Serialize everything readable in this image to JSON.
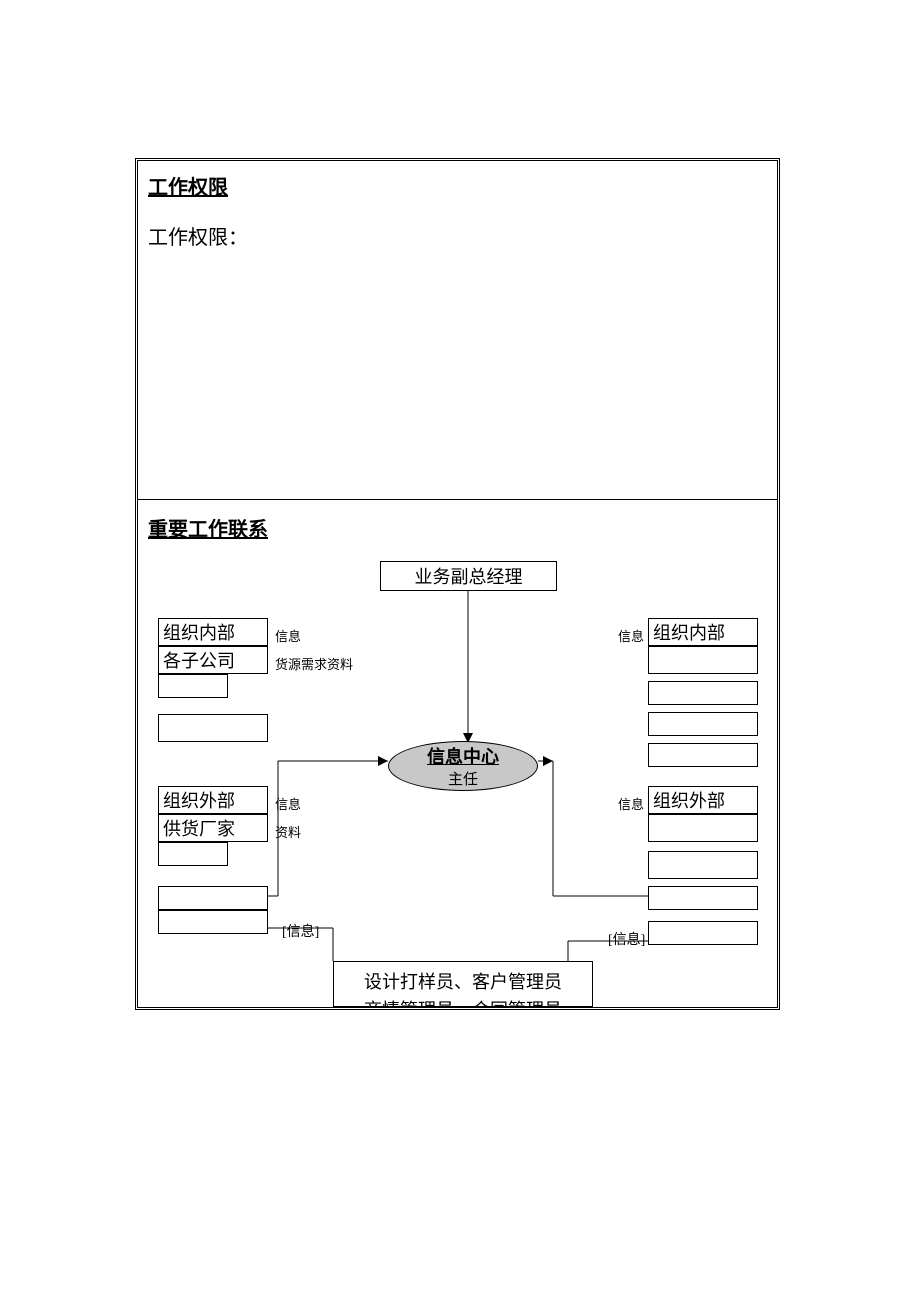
{
  "section1": {
    "title": "工作权限",
    "text": "工作权限："
  },
  "section2": {
    "title": "重要工作联系"
  },
  "diagram": {
    "top_box": "业务副总经理",
    "center_line1": "信息中心",
    "center_line2": "主任",
    "left": {
      "header1": "组织内部",
      "label1a": "信息",
      "row2": "各子公司",
      "label1b": "货源需求资料",
      "header2": "组织外部",
      "label2a": "信息",
      "row2b": "供货厂家",
      "label2b": "资料",
      "bottom_label": "[信息]"
    },
    "right": {
      "header1": "组织内部",
      "label1": "信息",
      "header2": "组织外部",
      "label2": "信息",
      "bottom_label": "[信息]"
    },
    "bottom_line1": "设计打样员、客户管理员",
    "bottom_line2": "商情管理员、合同管理员"
  }
}
